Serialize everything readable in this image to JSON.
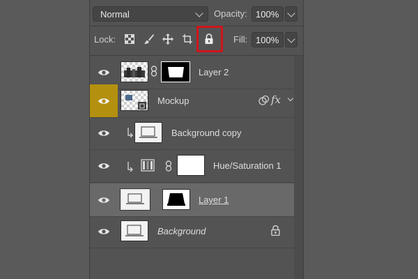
{
  "blend": {
    "mode": "Normal"
  },
  "opacity": {
    "label": "Opacity:",
    "value": "100%"
  },
  "lock": {
    "label": "Lock:"
  },
  "fill": {
    "label": "Fill:",
    "value": "100%"
  },
  "layers": [
    {
      "name": "Layer 2"
    },
    {
      "name": "Mockup",
      "fx": "fx"
    },
    {
      "name": "Background copy"
    },
    {
      "name": "Hue/Saturation 1"
    },
    {
      "name": "Layer 1"
    },
    {
      "name": "Background"
    }
  ],
  "colors": {
    "accent_eye": "#b4900f",
    "highlight": "#d0141b",
    "selected_row": "#696969"
  }
}
